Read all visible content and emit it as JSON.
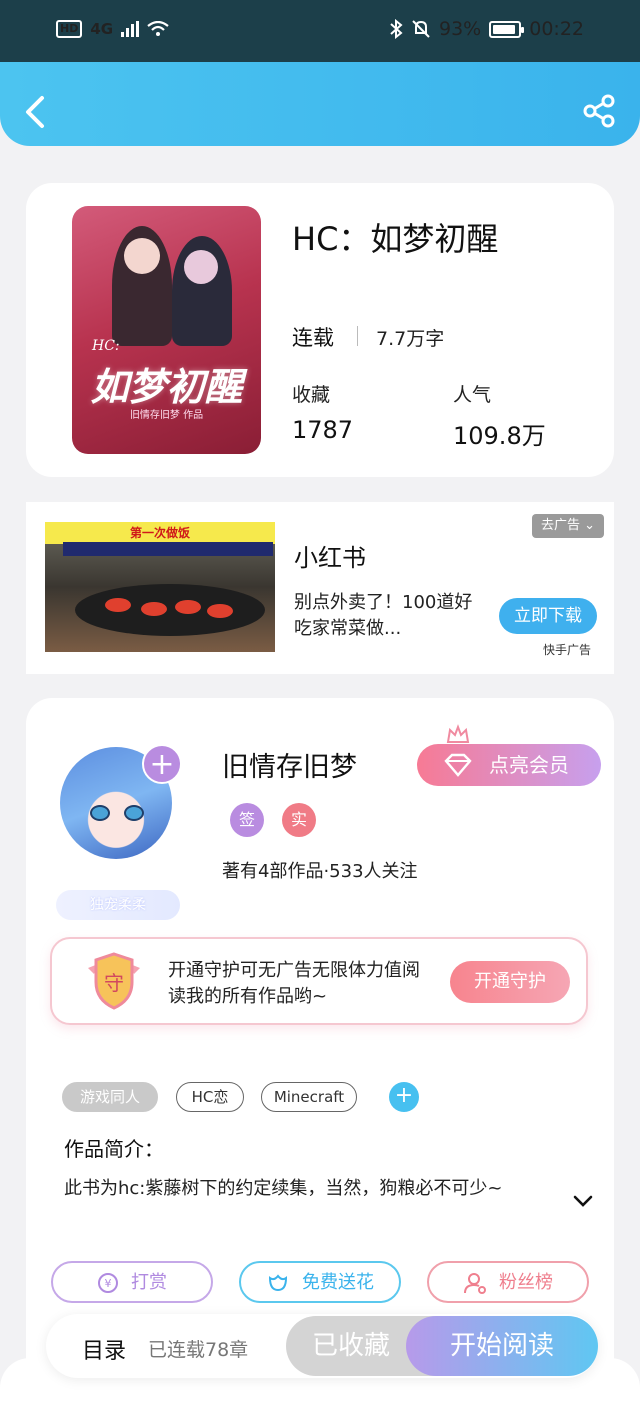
{
  "status_bar": {
    "hd": "HD",
    "network": "4G",
    "battery": "93%",
    "time": "00:22"
  },
  "colors": {
    "header": "#4cc4f0",
    "accent_pink": "#f77a94",
    "accent_purple": "#b98ce0",
    "accent_blue": "#47c0f0"
  },
  "book": {
    "cover_title": "如梦初醒",
    "cover_prefix": "HC:",
    "cover_author_line": "旧情存旧梦 作品",
    "title": "HC：如梦初醒",
    "status": "连载",
    "word_count": "7.7万字",
    "collect_label": "收藏",
    "collect_value": "1787",
    "popularity_label": "人气",
    "popularity_value": "109.8万"
  },
  "ad": {
    "banner_text": "第一次做饭",
    "close_label": "去广告",
    "title": "小红书",
    "description": "别点外卖了！100道好吃家常菜做...",
    "button": "立即下载",
    "source": "快手广告"
  },
  "author": {
    "name": "旧情存旧梦",
    "frame_label": "独宠柔柔",
    "vip_button": "点亮会员",
    "badge_sign": "签",
    "badge_real": "实",
    "stats": "著有4部作品·533人关注",
    "guard_text": "开通守护可无广告无限体力值阅读我的所有作品哟~",
    "guard_shield": "守",
    "guard_button": "开通守护"
  },
  "tags": [
    "游戏同人",
    "HC恋",
    "Minecraft"
  ],
  "intro": {
    "title": "作品简介：",
    "text": "此书为hc:紫藤树下的约定续集，当然，狗粮必不可少~"
  },
  "actions": {
    "tip": "打赏",
    "flower": "免费送花",
    "fans": "粉丝榜"
  },
  "bottom": {
    "toc": "目录",
    "chapters": "已连载78章",
    "collected": "已收藏",
    "start": "开始阅读"
  }
}
